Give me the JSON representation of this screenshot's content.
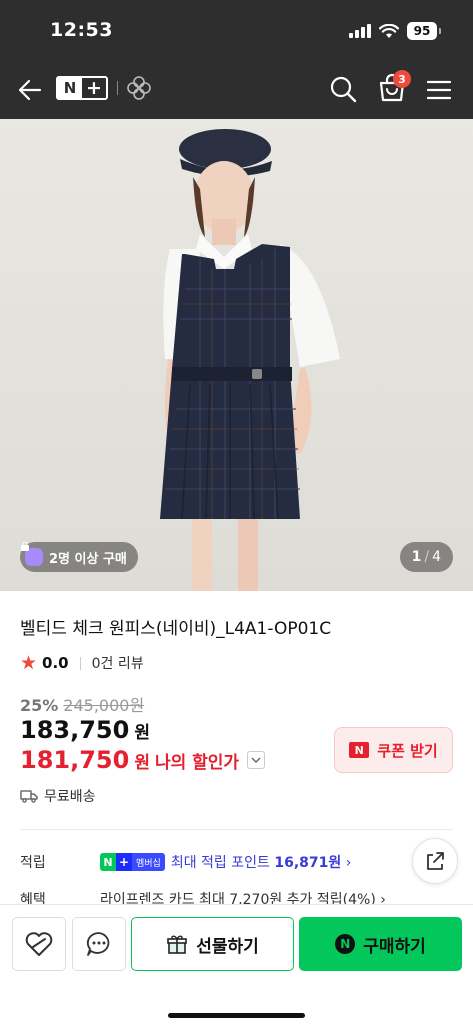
{
  "status_bar": {
    "time": "12:53",
    "battery": "95",
    "icons": [
      "signal-icon",
      "wifi-icon",
      "battery-icon"
    ]
  },
  "header": {
    "logo_n": "N",
    "logo_plus": "+",
    "icons": [
      "back-arrow-icon",
      "brand-clover-icon",
      "search-icon",
      "cart-icon",
      "menu-icon"
    ],
    "cart_count": "3"
  },
  "gallery": {
    "group_badge": "2명 이상 구매",
    "page_current": "1",
    "page_sep": "/",
    "page_total": "4"
  },
  "product": {
    "title": "벨티드 체크 원피스(네이비)_L4A1-OP01C",
    "rating": "0.0",
    "reviews": "0건 리뷰",
    "discount_rate": "25%",
    "original_price": "245,000원",
    "price": "183,750",
    "price_unit": "원",
    "my_price": "181,750",
    "my_price_unit": "원",
    "my_price_label": "나의 할인가",
    "coupon_button": "쿠폰 받기",
    "coupon_n": "N",
    "shipping": "무료배송"
  },
  "benefits": {
    "points_label": "적립",
    "np_n": "N",
    "np_plus": "+",
    "np_membership": "멤버십",
    "points_text": "최대 적립 포인트",
    "points_amount": "16,871원",
    "points_chevron": "›",
    "benefit_label": "혜택",
    "benefit_text": "라이프렌즈 카드 최대 7,270원 추가 적립(4%) ›"
  },
  "bottom_bar": {
    "gift_label": "선물하기",
    "buy_label": "구매하기",
    "buy_n": "N"
  },
  "colors": {
    "header_bg": "#2e2e2e",
    "accent_green": "#03c75a",
    "sale_red": "#e5202f",
    "points_blue": "#3a3ad9"
  }
}
